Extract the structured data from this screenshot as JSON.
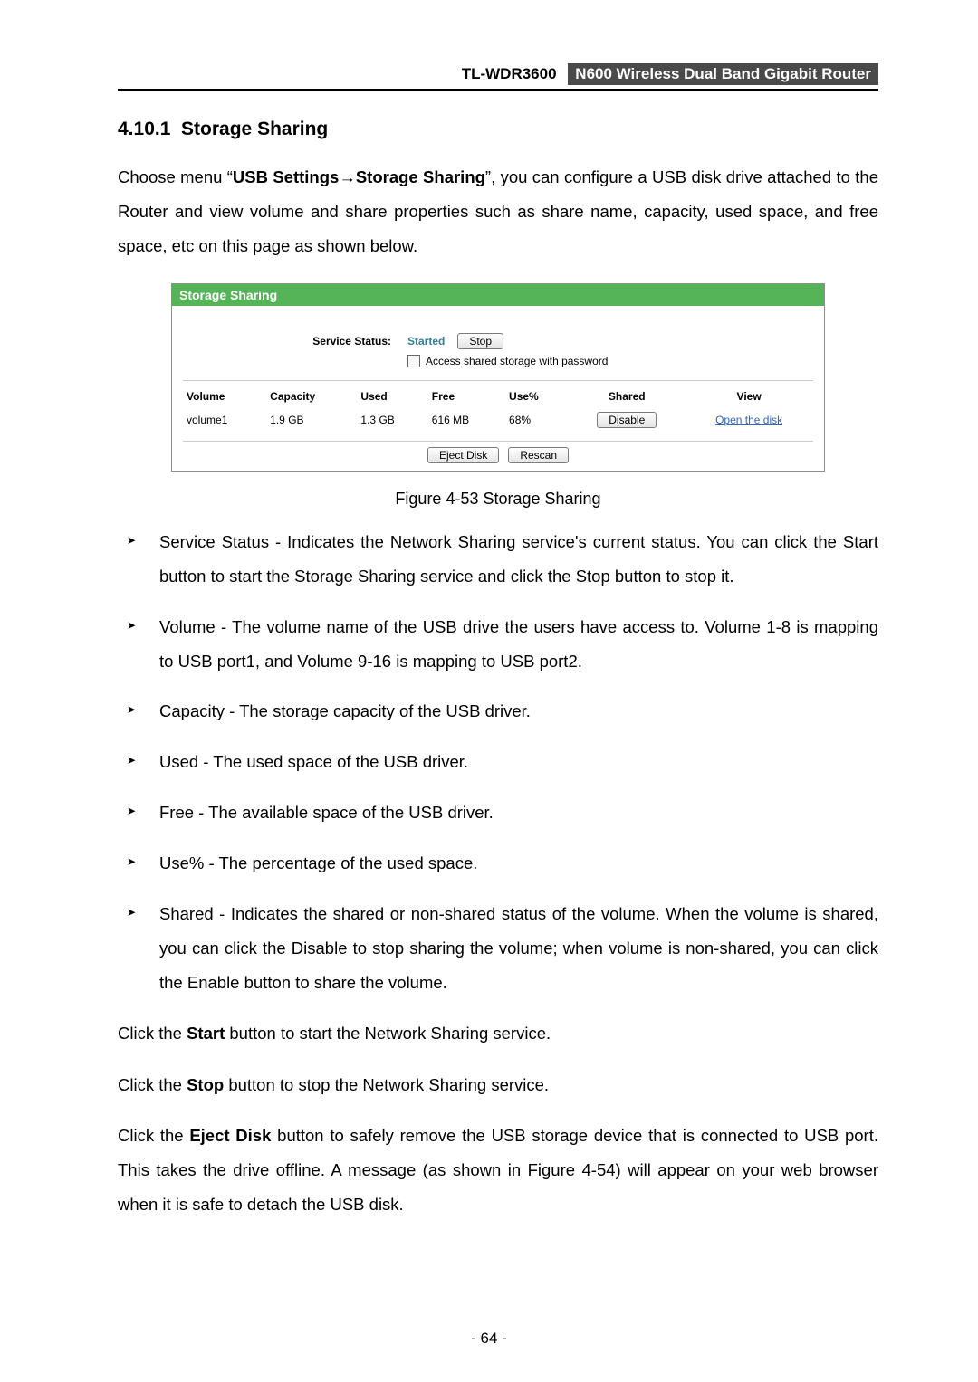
{
  "header": {
    "model": "TL-WDR3600",
    "product": "N600 Wireless Dual Band Gigabit Router"
  },
  "section_title": "4.10.1  Storage Sharing",
  "intro": {
    "p1_a": "Choose menu “",
    "p1_b": "USB Settings→Storage Sharing",
    "p1_c": "”, you can configure a USB disk drive attached to the Router and view volume and share properties such as share name, capacity, used space, and free space, etc on this page as shown below."
  },
  "panel": {
    "title": "Storage Sharing",
    "service_status_label": "Service Status:",
    "service_status_value": "Started",
    "stop_btn": "Stop",
    "checkbox_label": "Access shared storage with password",
    "headers": {
      "volume": "Volume",
      "capacity": "Capacity",
      "used": "Used",
      "free": "Free",
      "usepct": "Use%",
      "shared": "Shared",
      "view": "View"
    },
    "row": {
      "volume": "volume1",
      "capacity": "1.9 GB",
      "used": "1.3 GB",
      "free": "616 MB",
      "usepct": "68%",
      "shared_btn": "Disable",
      "view_link": "Open the disk"
    },
    "eject_btn": "Eject Disk",
    "rescan_btn": "Rescan"
  },
  "figure_caption": "Figure 4-53 Storage Sharing",
  "bullets": {
    "service_status": {
      "term": "Service Status",
      "text_a": " - Indicates the Network Sharing service's current status. You can click the ",
      "text_b": "Start",
      "text_c": " button to start the Storage Sharing service and click the ",
      "text_d": "Stop",
      "text_e": " button to stop it."
    },
    "volume": {
      "term": "Volume",
      "text": " - The volume name of the USB drive the users have access to. Volume 1-8 is mapping to USB port1, and Volume 9-16 is mapping to USB port2."
    },
    "capacity": {
      "term": "Capacity",
      "text": " - The storage capacity of the USB driver."
    },
    "used": {
      "term": "Used",
      "text": " - The used space of the USB driver."
    },
    "free": {
      "term": "Free",
      "text": " - The available space of the USB driver."
    },
    "usepct": {
      "term": "Use%",
      "text": " - The percentage of the used space."
    },
    "shared": {
      "term": "Shared",
      "text_a": " - Indicates the shared or non-shared status of the volume. When the volume is shared, you can click the ",
      "text_b": "Disable",
      "text_c": " to stop sharing the volume; when volume is non-shared, you can click the ",
      "text_d": "Enable",
      "text_e": " button to share the volume."
    }
  },
  "tail": {
    "p1_a": "Click the ",
    "p1_b": "Start",
    "p1_c": " button to start the Network Sharing service.",
    "p2_a": "Click the ",
    "p2_b": "Stop",
    "p2_c": " button to stop the Network Sharing service.",
    "p3_a": "Click the ",
    "p3_b": "Eject Disk",
    "p3_c": " button to safely remove the USB storage device that is connected to USB port. This takes the drive offline. A message (as shown in Figure 4-54) will appear on your web browser when it is safe to detach the USB disk."
  },
  "page_number": "- 64 -"
}
